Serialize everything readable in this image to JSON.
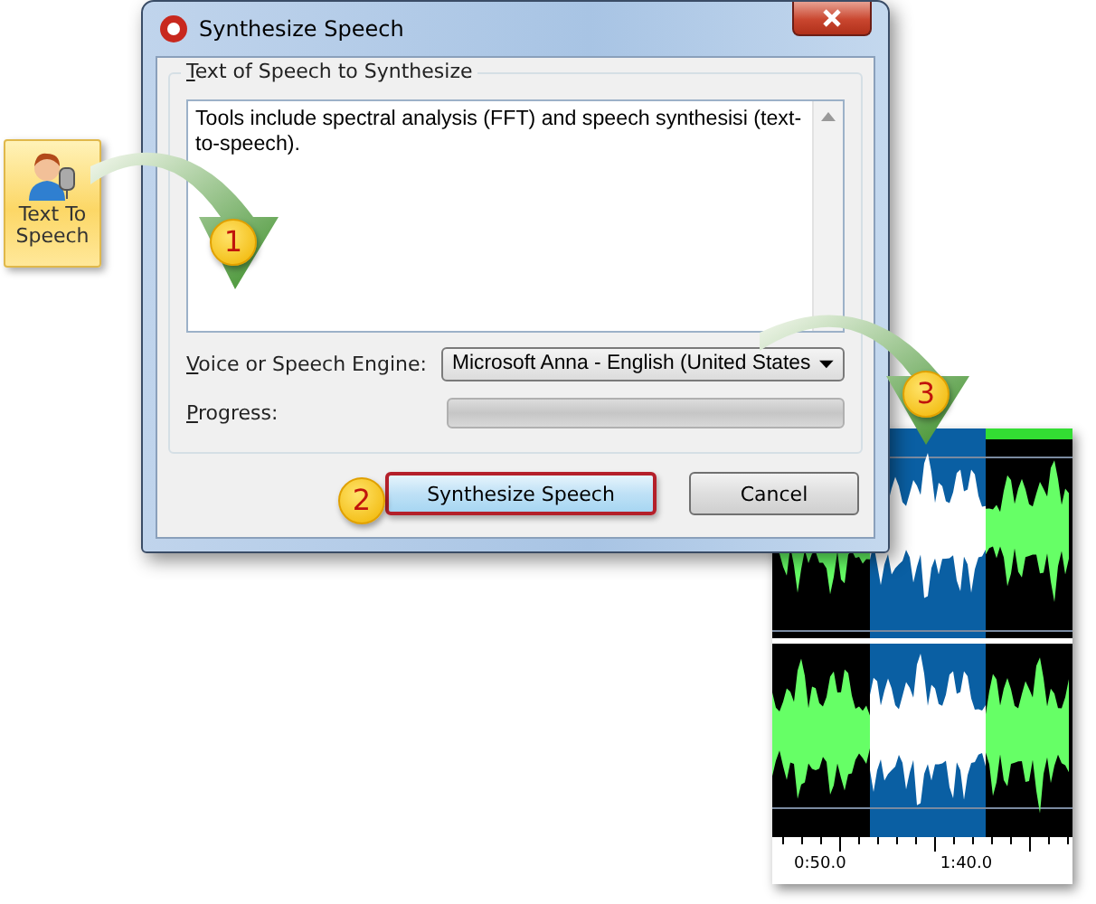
{
  "ribbon_button": {
    "label": "Text To Speech"
  },
  "dialog": {
    "title": "Synthesize Speech",
    "group_label": "Text of Speech to Synthesize",
    "speech_text": "Tools include spectral analysis (FFT) and speech synthesisi (text-to-speech).",
    "voice_label": "Voice or Speech Engine:",
    "voice_value": "Microsoft Anna - English (United States",
    "progress_label": "Progress:",
    "progress": {
      "level": 0
    },
    "buttons": [
      {
        "label": "Synthesize Speech",
        "highlighted": true
      },
      {
        "label": "Cancel",
        "highlighted": false
      }
    ]
  },
  "callouts": [
    "1",
    "2",
    "3"
  ],
  "waveform": {
    "time_labels": [
      "0:50.0",
      "1:40.0"
    ]
  }
}
